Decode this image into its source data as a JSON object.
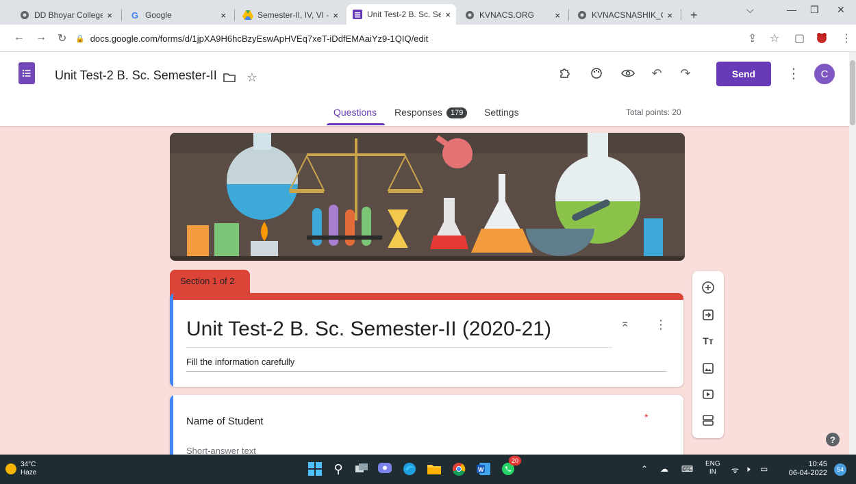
{
  "browser": {
    "tabs": [
      {
        "label": "DD Bhoyar College",
        "close": "×"
      },
      {
        "label": "Google",
        "close": "×"
      },
      {
        "label": "Semester-II, IV, VI -",
        "close": "×"
      },
      {
        "label": "Unit Test-2 B. Sc. Se",
        "close": "×"
      },
      {
        "label": "KVNACS.ORG",
        "close": "×"
      },
      {
        "label": "KVNACSNASHIK_C",
        "close": "×"
      }
    ],
    "new_tab": "+",
    "url": "docs.google.com/forms/d/1jpXA9H6hcBzyEswApHVEq7xeT-iDdfEMAaiYz9-1QIQ/edit"
  },
  "form_header": {
    "title": "Unit Test-2 B. Sc. Semester-II",
    "send_label": "Send",
    "avatar_letter": "C",
    "tabs": {
      "questions": "Questions",
      "responses": "Responses",
      "responses_count": "179",
      "settings": "Settings"
    },
    "total_points": "Total points: 20"
  },
  "section": {
    "label": "Section 1 of 2",
    "title": "Unit Test-2 B. Sc. Semester-II (2020-21)",
    "description": "Fill the information carefully"
  },
  "question": {
    "title": "Name of Student",
    "required_mark": "*",
    "hint": "Short-answer text"
  },
  "help_label": "?",
  "taskbar": {
    "temperature": "34°C",
    "weather": "Haze",
    "lang_top": "ENG",
    "lang_bottom": "IN",
    "time": "10:45",
    "date": "06-04-2022",
    "notification_count": "54",
    "whatsapp_badge": "20"
  },
  "colors": {
    "accent": "#673ab7",
    "section": "#db4437",
    "background": "#f9dedc",
    "left_bar": "#4285f4"
  }
}
